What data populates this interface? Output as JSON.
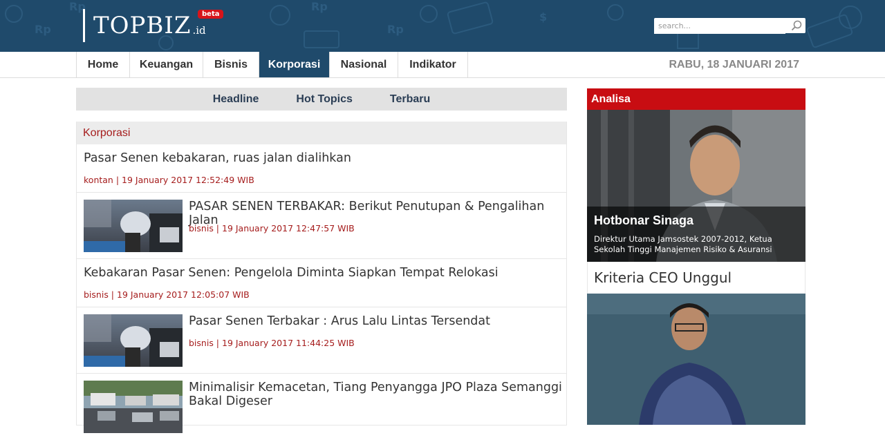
{
  "brand": {
    "logo_text": "TOPBIZ",
    "logo_suffix": ".id",
    "badge": "beta"
  },
  "search": {
    "placeholder": "search..."
  },
  "nav": {
    "items": [
      "Home",
      "Keuangan",
      "Bisnis",
      "Korporasi",
      "Nasional",
      "Indikator"
    ],
    "active": "Korporasi",
    "date": "RABU, 18 JANUARI 2017"
  },
  "subtabs": [
    "Headline",
    "Hot Topics",
    "Terbaru"
  ],
  "news": {
    "section": "Korporasi",
    "items": [
      {
        "title": "Pasar Senen kebakaran, ruas jalan dialihkan",
        "meta": "kontan | 19 January 2017 12:52:49 WIB",
        "has_thumb": false
      },
      {
        "title": "PASAR SENEN TERBAKAR: Berikut Penutupan & Pengalihan Jalan",
        "meta": "bisnis | 19 January 2017 12:47:57 WIB",
        "has_thumb": true
      },
      {
        "title": "Kebakaran Pasar Senen: Pengelola Diminta Siapkan Tempat Relokasi",
        "meta": "bisnis | 19 January 2017 12:05:07 WIB",
        "has_thumb": false
      },
      {
        "title": "Pasar Senen Terbakar : Arus Lalu Lintas Tersendat",
        "meta": "bisnis | 19 January 2017 11:44:25 WIB",
        "has_thumb": true
      },
      {
        "title": "Minimalisir Kemacetan, Tiang Penyangga JPO Plaza Semanggi Bakal Digeser",
        "meta": "",
        "has_thumb": true
      }
    ]
  },
  "analisa": {
    "header": "Analisa",
    "name": "Hotbonar Sinaga",
    "desc": "Direktur Utama Jamsostek 2007-2012, Ketua Sekolah Tinggi Manajemen Risiko & Asuransi",
    "next_title": "Kriteria CEO Unggul"
  },
  "colors": {
    "header_bg": "#1f4a6b",
    "accent_red": "#c80d12",
    "meta_red": "#a51c1c"
  }
}
